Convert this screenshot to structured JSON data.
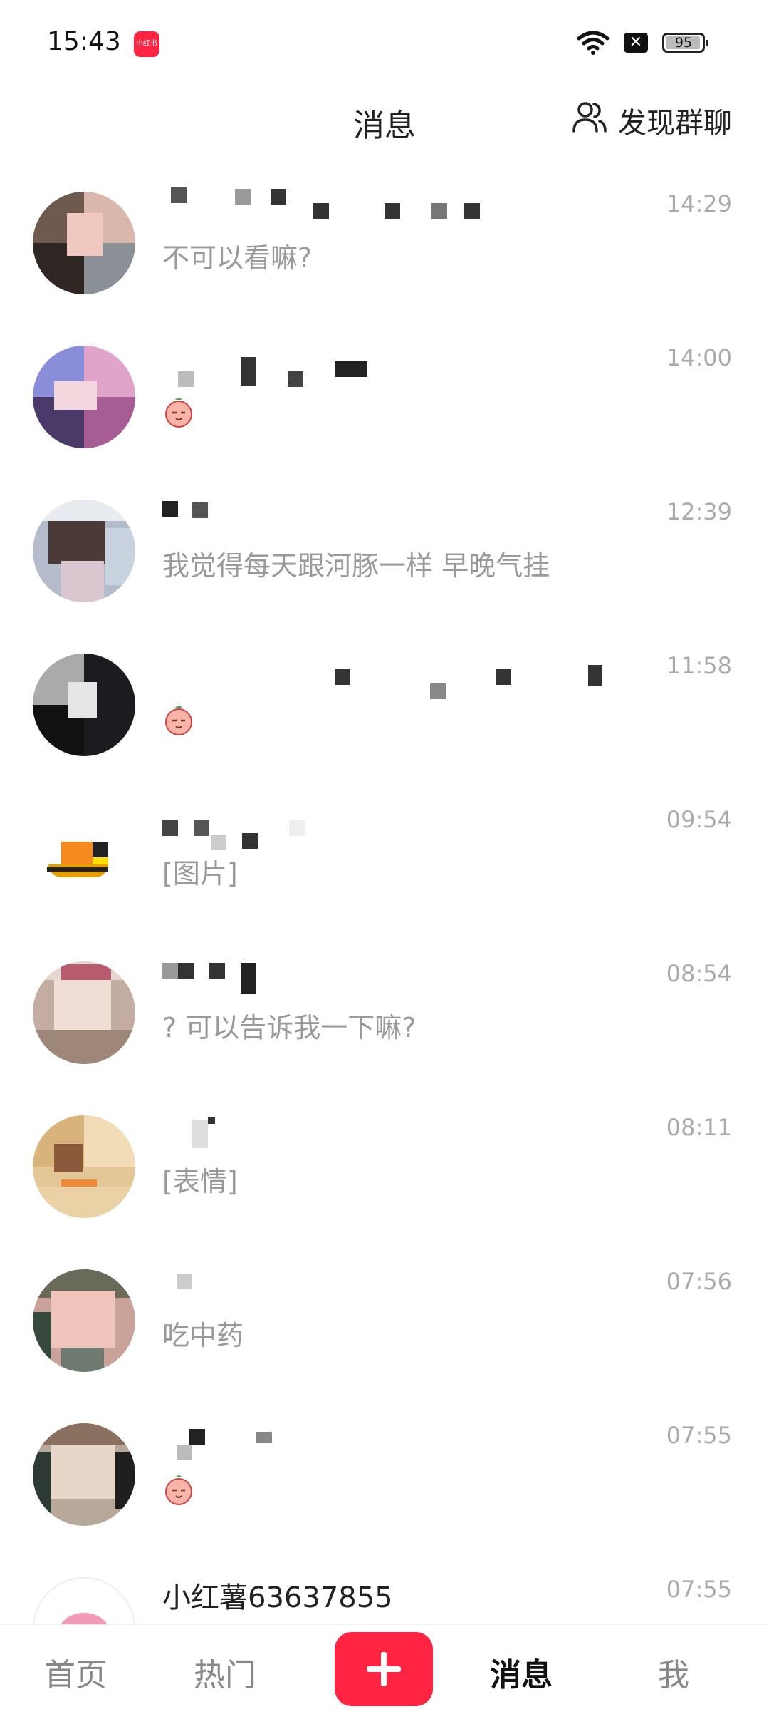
{
  "status_bar": {
    "time": "15:43",
    "app_badge": "小红书",
    "battery": "95",
    "battery_level": 0.95
  },
  "header": {
    "title": "消息",
    "discover_group_label": "发现群聊"
  },
  "conversations": [
    {
      "name": "",
      "preview": "不可以看嘛?",
      "time": "14:29",
      "has_emoji": false
    },
    {
      "name": "",
      "preview": "",
      "time": "14:00",
      "has_emoji": true
    },
    {
      "name": "",
      "preview": "我觉得每天跟河豚一样 早晚气挂",
      "time": "12:39",
      "has_emoji": false
    },
    {
      "name": "",
      "preview": "",
      "time": "11:58",
      "has_emoji": true
    },
    {
      "name": "",
      "preview": "[图片]",
      "time": "09:54",
      "has_emoji": false
    },
    {
      "name": "",
      "preview": "? 可以告诉我一下嘛?",
      "time": "08:54",
      "has_emoji": false
    },
    {
      "name": "",
      "preview": "[表情]",
      "time": "08:11",
      "has_emoji": false
    },
    {
      "name": "",
      "preview": "吃中药",
      "time": "07:56",
      "has_emoji": false
    },
    {
      "name": "",
      "preview": "",
      "time": "07:55",
      "has_emoji": true
    },
    {
      "name": "小红薯63637855",
      "preview": "",
      "time": "07:55",
      "has_emoji": false
    }
  ],
  "tab_bar": {
    "home": "首页",
    "hot": "热门",
    "post": "+",
    "messages": "消息",
    "me": "我"
  },
  "colors": {
    "brand": "#ff2442",
    "time_text": "#aaaaaa",
    "preview_text": "#999999"
  }
}
